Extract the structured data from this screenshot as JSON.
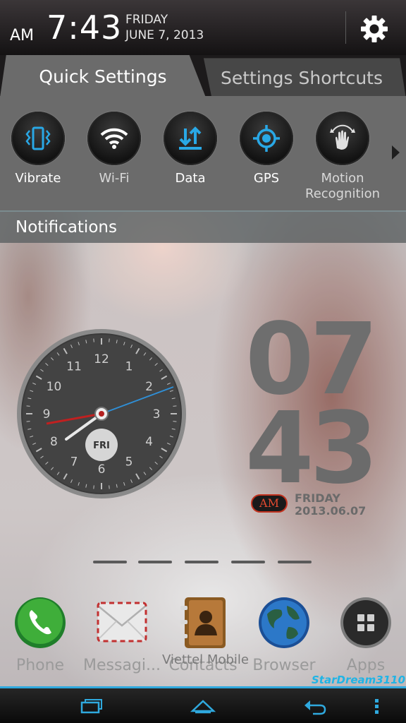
{
  "header": {
    "ampm": "AM",
    "time": "7:43",
    "day": "FRIDAY",
    "date": "JUNE 7, 2013",
    "settings_icon": "gear-icon"
  },
  "tabs": [
    {
      "label": "Quick Settings",
      "active": true
    },
    {
      "label": "Settings Shortcuts",
      "active": false
    }
  ],
  "quick_settings": [
    {
      "label": "Vibrate",
      "icon": "vibrate-icon",
      "on": true
    },
    {
      "label": "Wi-Fi",
      "icon": "wifi-icon",
      "on": false
    },
    {
      "label": "Data",
      "icon": "data-icon",
      "on": true
    },
    {
      "label": "GPS",
      "icon": "gps-icon",
      "on": true
    },
    {
      "label": "Motion Recognition",
      "label_line1": "Motion",
      "label_line2": "Recognition",
      "icon": "motion-recognition-icon",
      "on": false
    }
  ],
  "notifications": {
    "title": "Notifications"
  },
  "analog_clock": {
    "numbers": [
      "12",
      "1",
      "2",
      "3",
      "4",
      "5",
      "6",
      "7",
      "8",
      "9",
      "10",
      "11"
    ],
    "day_badge": "FRI"
  },
  "digital_clock": {
    "hour": "07",
    "minute": "43",
    "ampm": "AM",
    "day": "FRIDAY",
    "date": "2013.06.07"
  },
  "dock": [
    {
      "label": "Phone",
      "icon": "phone-icon"
    },
    {
      "label": "Messagi...",
      "icon": "messaging-icon"
    },
    {
      "label": "Contacts",
      "icon": "contacts-icon"
    },
    {
      "label": "Browser",
      "icon": "browser-icon"
    },
    {
      "label": "Apps",
      "icon": "apps-grid-icon"
    }
  ],
  "carrier": "Viettel Mobile",
  "watermark": "StarDream3110",
  "nav": {
    "recent": "recent-apps-icon",
    "home": "home-icon",
    "back": "back-icon",
    "menu": "menu-icon"
  },
  "colors": {
    "accent": "#1fa7e3",
    "bar": "#2fa9de",
    "toggle_on": "#29a8e6"
  }
}
